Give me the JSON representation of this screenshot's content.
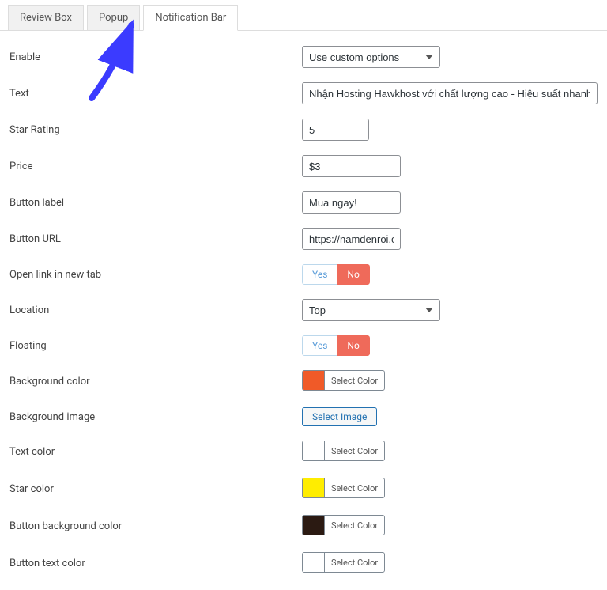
{
  "tabs": {
    "review": "Review Box",
    "popup": "Popup",
    "notif": "Notification Bar"
  },
  "labels": {
    "enable": "Enable",
    "text": "Text",
    "star_rating": "Star Rating",
    "price": "Price",
    "button_label": "Button label",
    "button_url": "Button URL",
    "open_new_tab": "Open link in new tab",
    "location": "Location",
    "floating": "Floating",
    "bg_color": "Background color",
    "bg_image": "Background image",
    "text_color": "Text color",
    "star_color": "Star color",
    "btn_bg_color": "Button background color",
    "btn_text_color": "Button text color"
  },
  "values": {
    "enable": "Use custom options",
    "text": "Nhận Hosting Hawkhost với chất lượng cao - Hiệu suất nhanh - Giá rẻ nhất phân khúc",
    "star_rating": "5",
    "price": "$3",
    "button_label": "Mua ngay!",
    "button_url": "https://namdenroi.com/i",
    "location": "Top"
  },
  "toggle": {
    "yes": "Yes",
    "no": "No"
  },
  "buttons": {
    "select_color": "Select Color",
    "select_image": "Select Image"
  },
  "colors": {
    "bg_color": "#f05a28",
    "text_color": "",
    "star_color": "#ffed00",
    "btn_bg_color": "#2b1a12",
    "btn_text_color": ""
  }
}
